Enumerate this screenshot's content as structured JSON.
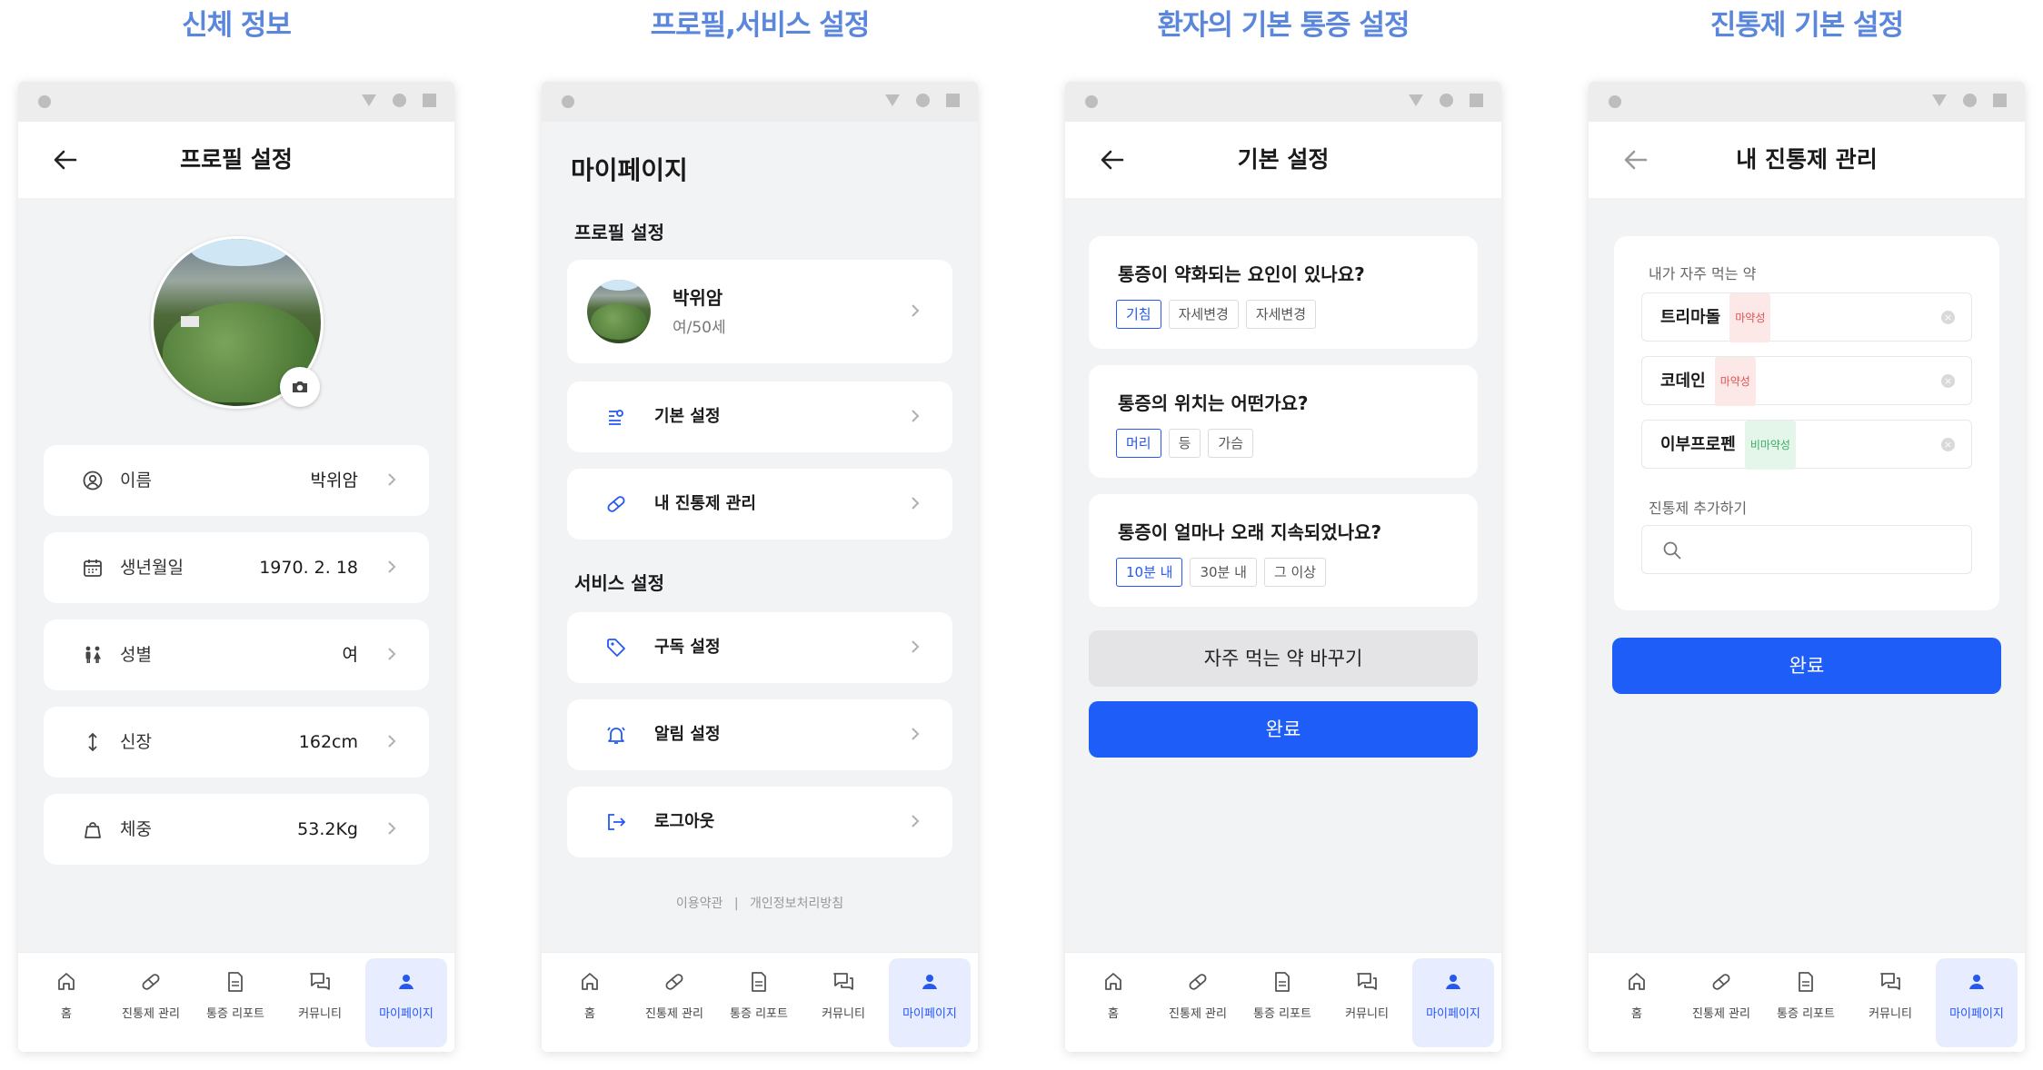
{
  "captions": [
    "신체 정보",
    "프로필,서비스 설정",
    "환자의 기본 통증 설정",
    "진통제 기본 설정"
  ],
  "tabs": [
    "홈",
    "진통제 관리",
    "통증 리포트",
    "커뮤니티",
    "마이페이지"
  ],
  "screen1": {
    "title": "프로필 설정",
    "rows": [
      {
        "label": "이름",
        "value": "박위암",
        "icon": "user-circle-icon"
      },
      {
        "label": "생년월일",
        "value": "1970. 2. 18",
        "icon": "calendar-icon"
      },
      {
        "label": "성별",
        "value": "여",
        "icon": "gender-icon"
      },
      {
        "label": "신장",
        "value": "162cm",
        "icon": "height-arrow-icon"
      },
      {
        "label": "체중",
        "value": "53.2Kg",
        "icon": "weight-icon"
      }
    ]
  },
  "screen2": {
    "title": "마이페이지",
    "profile_section": "프로필 설정",
    "profile_name": "박위암",
    "profile_sub": "여/50세",
    "menu1": [
      "기본 설정",
      "내 진통제 관리"
    ],
    "service_section": "서비스 설정",
    "menu2": [
      "구독 설정",
      "알림 설정",
      "로그아웃"
    ],
    "footer_terms": "이용약관",
    "footer_sep": "|",
    "footer_privacy": "개인정보처리방침"
  },
  "screen3": {
    "title": "기본 설정",
    "questions": [
      {
        "q": "통증이 약화되는 요인이 있나요?",
        "chips": [
          "기침",
          "자세변경",
          "자세변경"
        ],
        "selected": 0
      },
      {
        "q": "통증의 위치는 어떤가요?",
        "chips": [
          "머리",
          "등",
          "가슴"
        ],
        "selected": 0
      },
      {
        "q": "통증이 얼마나 오래 지속되었나요?",
        "chips": [
          "10분 내",
          "30분 내",
          "그 이상"
        ],
        "selected": 0
      }
    ],
    "change_button": "자주 먹는 약 바꾸기",
    "done_button": "완료"
  },
  "screen4": {
    "title": "내 진통제 관리",
    "frequent_label": "내가 자주 먹는 약",
    "drugs": [
      {
        "name": "트리마돌",
        "badge": "마약성",
        "color": "red"
      },
      {
        "name": "코데인",
        "badge": "마약성",
        "color": "red"
      },
      {
        "name": "이부프로펜",
        "badge": "비마약성",
        "color": "green"
      }
    ],
    "add_label": "진통제 추가하기",
    "search_placeholder": "",
    "done_button": "완료"
  },
  "colors": {
    "accent": "#1e5df7",
    "caption": "#5a87dc",
    "active_tab_bg": "#e7edff"
  }
}
